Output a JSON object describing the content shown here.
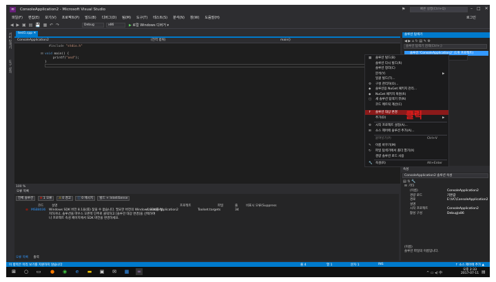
{
  "window": {
    "title": "ConsoleApplication2 - Microsoft Visual Studio",
    "quick_launch_placeholder": "빠른 실행(Ctrl+Q)",
    "login": "로그인"
  },
  "menubar": [
    "파일(F)",
    "편집(E)",
    "보기(V)",
    "프로젝트(P)",
    "빌드(B)",
    "디버그(D)",
    "팀(M)",
    "도구(T)",
    "테스트(S)",
    "분석(N)",
    "창(W)",
    "도움말(H)"
  ],
  "toolbar": {
    "config": "Debug",
    "platform": "x86",
    "run_label": "로컬 Windows 디버거"
  },
  "left_tabs": [
    "서버 탐색기",
    "도구 상자"
  ],
  "editor": {
    "tab": "test1.cpp",
    "nav_project": "ConsoleApplication2",
    "nav_scope": "(전역 범위)",
    "nav_member": "main()",
    "lines": {
      "l1_dir": "#include",
      "l1_str": "\"stdio.h\"",
      "l3_kw": "void",
      "l3_rest": "main() {",
      "l4_rest": "printf(",
      "l4_str": "\"asd\"",
      "l4_end": ");",
      "l5": "}"
    },
    "zoom": "100 %"
  },
  "error_list": {
    "header": "오류 목록",
    "scope": "전체 솔루션",
    "errors_btn": "1 오류",
    "warnings_btn": "0 경고",
    "messages_btn": "0 메시지",
    "filter": "빌드 + IntelliSense",
    "columns": [
      "코드",
      "설명",
      "프로젝트",
      "파일",
      "줄",
      "비표시 오류(Suppress"
    ],
    "row": {
      "code": "MSB8036",
      "desc_line1": "Windows SDK 버전 8.1을(를) 찾을 수 없습니다. 필요한 버전의 Windows SDK를 설",
      "desc_line2": "치하거나, 솔루션을 마우스 오른쪽 단추로 클릭하고 [솔루션 대상 변경]을 선택하여",
      "desc_line3": "나 프로젝트 속성 페이지에서 SDK 버전을 변경하세요.",
      "project": "ConsoleApplication2",
      "file": "Toolset.targets",
      "line": "34"
    },
    "bottom_tabs": [
      "오류 목록",
      "출력"
    ]
  },
  "statusbar": {
    "message": "이 항목은 미리 보기를 지원하지 않습니다",
    "line": "줄 4",
    "col": "열 1",
    "ch": "문자 1",
    "ins": "INS",
    "source_control": "↑ 소스 제어에 추가 ▲"
  },
  "solution_explorer": {
    "title": "솔루션 탐색기",
    "search_placeholder": "솔루션 탐색기 검색(Ctrl+;)",
    "selected": "솔루션 'ConsoleApplication2' (1개 프로젝트)",
    "popup": "Ctrl+Shift+B"
  },
  "context_menu": {
    "items": [
      {
        "label": "솔루션 빌드(B)",
        "icon": "build-icon",
        "shortcut": ""
      },
      {
        "label": "솔루션 다시 빌드(R)",
        "icon": "",
        "shortcut": ""
      },
      {
        "label": "솔루션 정리(C)",
        "icon": "",
        "shortcut": ""
      },
      {
        "label": "분석(Y)",
        "icon": "",
        "shortcut": "▶"
      },
      {
        "label": "일괄 빌드(T)...",
        "icon": "",
        "shortcut": ""
      },
      {
        "label": "구성 관리자(O)...",
        "icon": "gear-icon",
        "shortcut": ""
      },
      {
        "label": "솔루션용 NuGet 패키지 관리...",
        "icon": "nuget-icon",
        "shortcut": ""
      },
      {
        "label": "NuGet 패키지 복원(R)",
        "icon": "nuget-icon",
        "shortcut": ""
      },
      {
        "label": "새 솔루션 탐색기 뷰(N)",
        "icon": "window-icon",
        "shortcut": ""
      },
      {
        "label": "코드 메트릭 계산(C)",
        "icon": "",
        "shortcut": ""
      },
      {
        "label": "솔루션 대상 변경",
        "icon": "retarget-icon",
        "shortcut": ""
      },
      {
        "label": "추가(D)",
        "icon": "",
        "shortcut": "▶"
      },
      {
        "label": "시작 프로젝트 설정(A)...",
        "icon": "gear-icon",
        "shortcut": ""
      },
      {
        "label": "소스 제어에 솔루션 추가(A)...",
        "icon": "source-control-icon",
        "shortcut": ""
      },
      {
        "label": "붙여넣기(P)",
        "icon": "",
        "shortcut": "Ctrl+V"
      },
      {
        "label": "이름 바꾸기(M)",
        "icon": "rename-icon",
        "shortcut": ""
      },
      {
        "label": "파일 탐색기에서 폴더 열기(X)",
        "icon": "folder-icon",
        "shortcut": ""
      },
      {
        "label": "경량 솔루션 로드 사용",
        "icon": "",
        "shortcut": ""
      },
      {
        "label": "속성(R)",
        "icon": "wrench-icon",
        "shortcut": "Alt+Enter"
      }
    ],
    "click_label": "클릭"
  },
  "properties": {
    "title": "속성",
    "subject": "ConsoleApplication2  솔루션 속성",
    "category": "기타",
    "rows": [
      {
        "key": "(이름)",
        "value": "ConsoleApplication2"
      },
      {
        "key": "경량 로드",
        "value": "기본값"
      },
      {
        "key": "경로",
        "value": "E:\\VC\\ConsoleApplication2"
      },
      {
        "key": "설명",
        "value": ""
      },
      {
        "key": "시작 프로젝트",
        "value": "ConsoleApplication2"
      },
      {
        "key": "활성 구성",
        "value": "Debug|x86"
      }
    ],
    "desc_title": "(이름)",
    "desc_text": "솔루션 파일의 이름입니다."
  },
  "taskbar": {
    "time": "오후 2:33",
    "date": "2017-07-11"
  }
}
